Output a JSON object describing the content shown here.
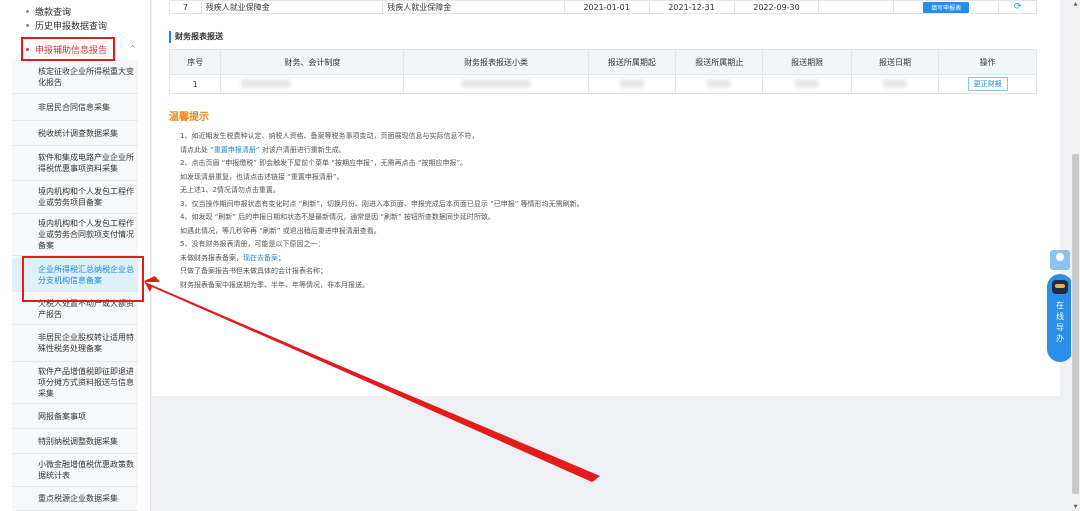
{
  "sidebar": {
    "top_items": [
      {
        "label": "缴款查询"
      },
      {
        "label": "历史申报数据查询"
      },
      {
        "label": "申报辅助信息报告",
        "chevron": "^"
      }
    ],
    "sub_items": [
      {
        "label": "核定征收企业所得税重大变化报告"
      },
      {
        "label": "非居民合同信息采集"
      },
      {
        "label": "税收统计调查数据采集"
      },
      {
        "label": "软件和集成电路产业企业所得税优惠事项资料采集"
      },
      {
        "label": "境内机构和个人发包工程作业或劳务项目备案"
      },
      {
        "label": "境内机构和个人发包工程作业或劳务合同款项支付情况备案"
      },
      {
        "label": "企业所得税汇总纳税企业总分支机构信息备案"
      },
      {
        "label": "欠税人处置不动产或大额资产报告"
      },
      {
        "label": "非居民企业股权转让适用特殊性税务处理备案"
      },
      {
        "label": "软件产品增值税即征即退进项分摊方式资料报送与信息采集"
      },
      {
        "label": "网报备案事项"
      },
      {
        "label": "特别纳税调整数据采集"
      },
      {
        "label": "小微金融增值税优惠政策数据统计表"
      },
      {
        "label": "重点税源企业数据采集"
      }
    ]
  },
  "top_row": {
    "index": "7",
    "col2": "残疾人就业保障金",
    "col3": "残疾人就业保障金",
    "start": "2021-01-01",
    "end": "2021-12-31",
    "deadline": "2022-09-30",
    "button": "填写申报表",
    "refresh_icon": "refresh-icon"
  },
  "report_section": {
    "title": "财务报表报送",
    "headers": [
      "序号",
      "财务、会计制度",
      "财务报表报送小类",
      "报送所属期起",
      "报送所属期止",
      "报送期限",
      "报送日期",
      "操作"
    ],
    "rows": [
      {
        "index": "1",
        "action": "更正财报"
      }
    ]
  },
  "tips": {
    "title": "温馨提示",
    "lines": [
      {
        "pre": "1、如近期发生税费种认定、纳税人资格、备案等税务事项变动，页面展现信息与实际信息不符，",
        "hl": "",
        "post": ""
      },
      {
        "pre": "请点此处 ",
        "hl": "“重置申报清册”",
        "post": " 对该户清册进行重新生成。"
      },
      {
        "pre": "2、点击页眉 “申报缴税” 即会触发下屋前个菜单 “按期应申报”，无需再点击 “按期应申报”。",
        "hl": "",
        "post": ""
      },
      {
        "pre": "如发现清册重复，也请点击述链接 “重置申报清册”。",
        "hl": "",
        "post": ""
      },
      {
        "pre": "无上述1、2情况请勿点击重置。",
        "hl": "",
        "post": ""
      },
      {
        "pre": "3、仅当操作期间申报状态有变化时点 “刷新”，切换月份、刚进入本页面、申报完成后本页面已显示 “已申报” 等情形均无需刷新。",
        "hl": "",
        "post": ""
      },
      {
        "pre": "4、如发现 “刷新” 后的申报日期和状态不是最新情况，通常是因 “刷新” 按钮所查数据同步延时所致。",
        "hl": "",
        "post": ""
      },
      {
        "pre": "如遇此情况，等几秒钟再 “刷新” 或退出稍后重进申报清册查看。",
        "hl": "",
        "post": ""
      },
      {
        "pre": "5、没有财务报表清册，可能是以下原因之一：",
        "hl": "",
        "post": ""
      },
      {
        "pre": "未做财务报表备案，",
        "hl": "现在去备案",
        "post": "；"
      },
      {
        "pre": "只做了备案报告书但未做具体的会计报表名称；",
        "hl": "",
        "post": ""
      },
      {
        "pre": "财务报表备案中报送期为季、半年、年等情况，非本月报送。",
        "hl": "",
        "post": ""
      }
    ]
  },
  "float_widget": {
    "label": "在线导办"
  },
  "scrollbar": {
    "up": "▲",
    "down": "▼"
  },
  "colors": {
    "accent": "#1a8ad6",
    "annotation": "#e31b1b",
    "tips_title": "#ef8a1e"
  }
}
